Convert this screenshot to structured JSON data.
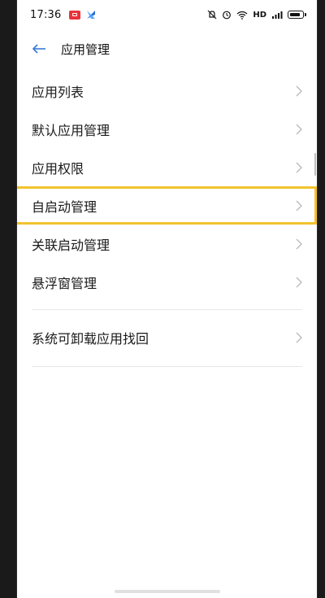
{
  "status_bar": {
    "time": "17:36",
    "network": "HD"
  },
  "header": {
    "title": "应用管理"
  },
  "menu": {
    "group1": [
      {
        "label": "应用列表"
      },
      {
        "label": "默认应用管理"
      },
      {
        "label": "应用权限"
      },
      {
        "label": "自启动管理"
      },
      {
        "label": "关联启动管理"
      },
      {
        "label": "悬浮窗管理"
      }
    ],
    "group2": [
      {
        "label": "系统可卸载应用找回"
      }
    ]
  },
  "colors": {
    "highlight_border": "#f2c22e",
    "back_arrow": "#3a78d6"
  },
  "icons": [
    "back-arrow-icon",
    "chevron-right-icon",
    "wifi-icon",
    "signal-icon",
    "battery-icon",
    "alarm-icon",
    "mute-icon"
  ]
}
